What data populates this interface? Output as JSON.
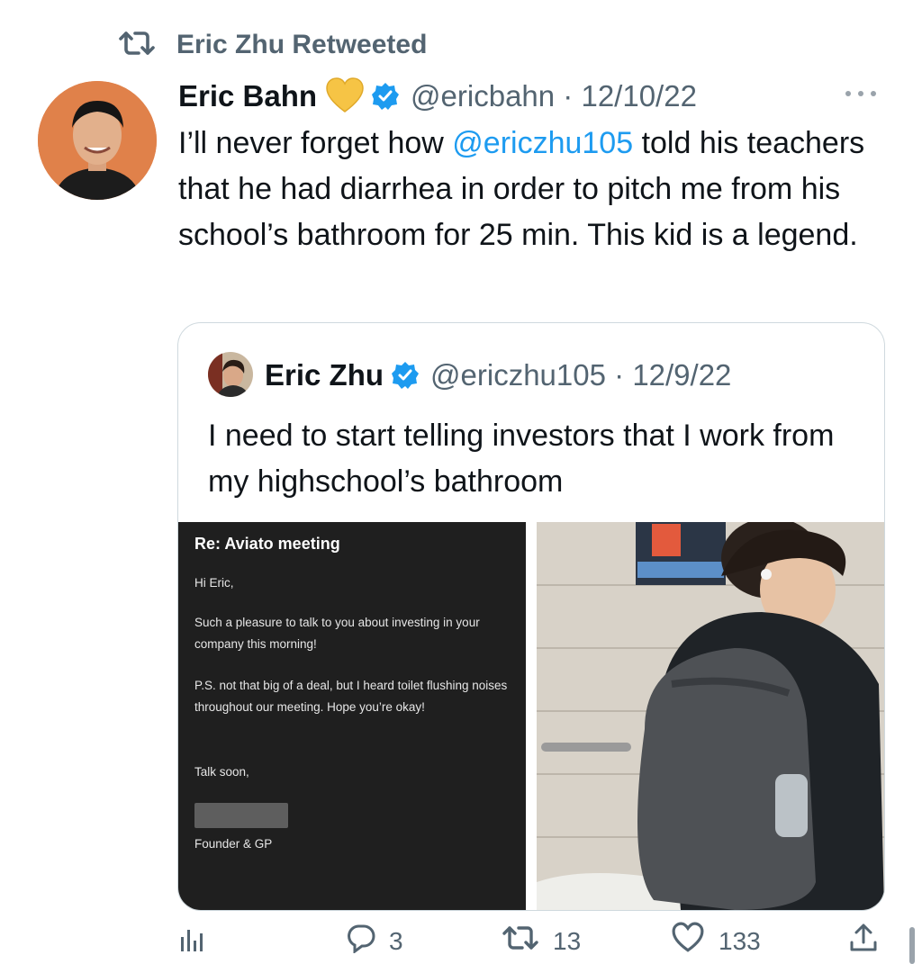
{
  "retweet": {
    "label": "Eric Zhu Retweeted",
    "icon": "retweet-icon"
  },
  "tweet": {
    "name": "Eric Bahn",
    "badge_icon": "yellow-heart-icon",
    "verified_icon": "verified-badge-icon",
    "handle": "@ericbahn",
    "date_sep": " · ",
    "date": "12/10/22",
    "more_icon": "more-icon",
    "text_before": "I’ll never forget how ",
    "mention": "@ericzhu105",
    "text_after": " told his teachers that he had diarrhea in order to pitch me from his school’s bathroom for 25 min. This kid is a legend."
  },
  "quoted_tweet": {
    "name": "Eric Zhu",
    "verified_icon": "verified-badge-icon",
    "handle": "@ericzhu105",
    "date_sep": " · ",
    "date": "12/9/22",
    "text": "I need to start telling investors that I work from my highschool’s bathroom",
    "email": {
      "subject": "Re: Aviato meeting",
      "greeting": "Hi Eric,",
      "body1": "Such a pleasure to talk to you about investing in your company this morning!",
      "body2": "P.S. not that big of a deal, but I heard toilet flushing noises throughout our meeting. Hope you’re okay!",
      "closing": "Talk soon,",
      "signature_title": "Founder & GP"
    }
  },
  "actions": {
    "analytics_icon": "analytics-icon",
    "reply_icon": "reply-icon",
    "reply_count": "3",
    "retweet_icon": "retweet-icon",
    "retweet_count": "13",
    "like_icon": "like-icon",
    "like_count": "133",
    "share_icon": "share-icon"
  },
  "colors": {
    "accent": "#1d9bf0",
    "secondary_text": "#536471",
    "primary_text": "#0f1419",
    "avatar_bg": "#e0814a",
    "email_bg": "#1f1f1f"
  }
}
